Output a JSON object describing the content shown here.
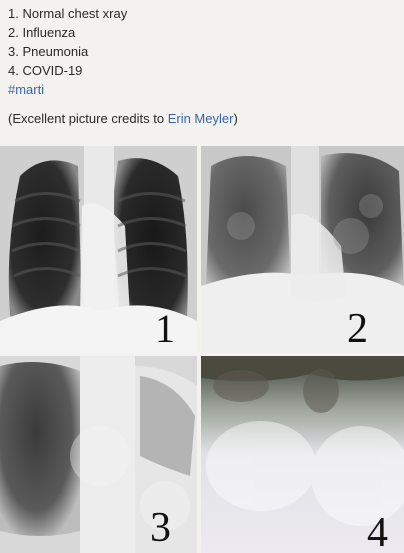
{
  "post": {
    "list": [
      "1. Normal chest xray",
      "2. Influenza",
      "3. Pneumonia",
      "4. COVID-19"
    ],
    "hashtag": "#marti",
    "credits_prefix": "(Excellent picture credits to ",
    "credits_name": "Erin Meyler",
    "credits_suffix": ")"
  },
  "images": [
    {
      "label": "1",
      "subject": "normal-chest-xray"
    },
    {
      "label": "2",
      "subject": "influenza-chest-xray"
    },
    {
      "label": "3",
      "subject": "pneumonia-chest-xray"
    },
    {
      "label": "4",
      "subject": "covid-19-chest-xray"
    }
  ],
  "colors": {
    "link": "#3b64a8",
    "text": "#2a2a2a"
  }
}
